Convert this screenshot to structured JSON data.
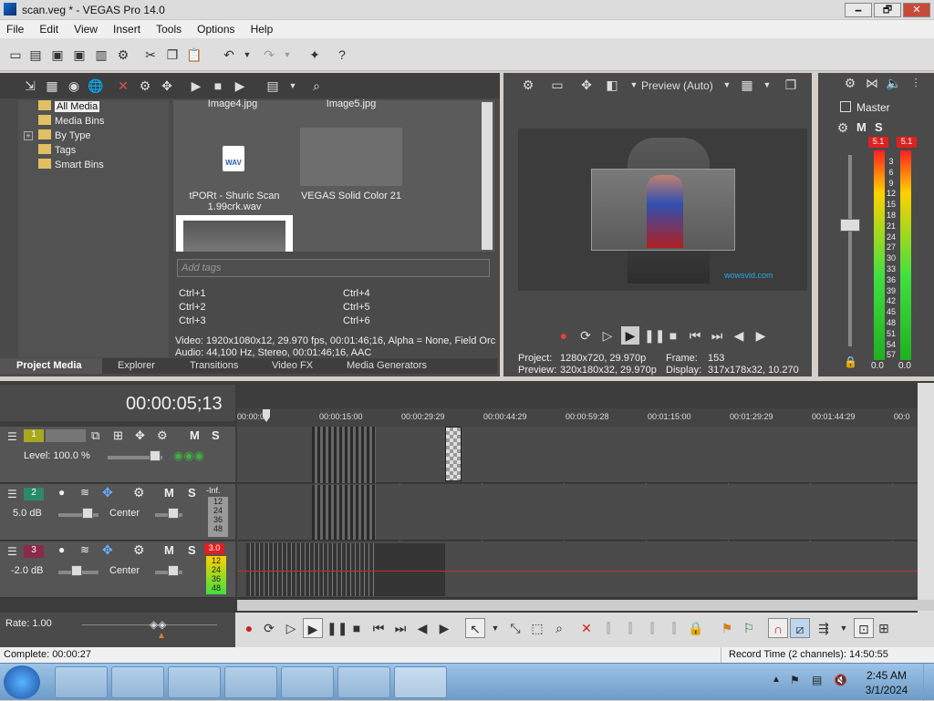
{
  "window": {
    "title": "scan.veg * - VEGAS Pro 14.0",
    "min": "🗕",
    "max": "🗗",
    "close": "✕"
  },
  "menu": [
    "File",
    "Edit",
    "View",
    "Insert",
    "Tools",
    "Options",
    "Help"
  ],
  "tree": [
    "All Media",
    "Media Bins",
    "By Type",
    "Tags",
    "Smart Bins"
  ],
  "tree_expand": "+",
  "media": {
    "top_captions": [
      "Image4.jpg",
      "Image5.jpg"
    ],
    "wav_caption": "tPORt - Shuric Scan 1.99crk.wav",
    "wav_icon_text": "WAV",
    "solid_caption": "VEGAS Solid Color 21",
    "tags_placeholder": "Add tags",
    "shortcuts": [
      "Ctrl+1",
      "Ctrl+4",
      "Ctrl+2",
      "Ctrl+5",
      "Ctrl+3",
      "Ctrl+6"
    ],
    "video_info": "Video: 1920x1080x12, 29.970 fps, 00:01:46;16, Alpha = None, Field Orc",
    "audio_info": "Audio: 44,100 Hz, Stereo, 00:01:46;16, AAC"
  },
  "tabs": [
    "Project Media",
    "Explorer",
    "Transitions",
    "Video FX",
    "Media Generators"
  ],
  "preview": {
    "mode": "Preview (Auto)",
    "project_label": "Project:",
    "project_value": "1280x720, 29.970p",
    "frame_label": "Frame:",
    "frame_value": "153",
    "preview_label": "Preview:",
    "preview_value": "320x180x32, 29.970p",
    "display_label": "Display:",
    "display_value": "317x178x32, 10.270",
    "watermark": "wowsvid.com"
  },
  "mixer": {
    "title": "Master",
    "m": "M",
    "s": "S",
    "peak_left": "5.1",
    "peak_right": "5.1",
    "scale": [
      "3",
      "6",
      "9",
      "12",
      "15",
      "18",
      "21",
      "24",
      "27",
      "30",
      "33",
      "36",
      "39",
      "42",
      "45",
      "48",
      "51",
      "54",
      "57"
    ],
    "bottom_left": "0.0",
    "bottom_right": "0.0"
  },
  "timeline": {
    "timecode": "00:00:05;13",
    "ruler": [
      "00:00:00",
      "00:00:15:00",
      "00:00:29:29",
      "00:00:44:29",
      "00:00:59:28",
      "00:01:15:00",
      "00:01:29:29",
      "00:01:44:29",
      "00:0"
    ],
    "tracks": [
      {
        "num": "1",
        "label": "Level: 100.0 %",
        "m": "M",
        "s": "S"
      },
      {
        "num": "2",
        "label": "5.0 dB",
        "pan": "Center",
        "m": "M",
        "s": "S",
        "meter": "-Inf."
      },
      {
        "num": "3",
        "label": "-2.0 dB",
        "pan": "Center",
        "m": "M",
        "s": "S",
        "meter": "3.0"
      }
    ],
    "meter_scale": [
      "12",
      "24",
      "36",
      "48"
    ],
    "rate": "Rate: 1.00"
  },
  "status": {
    "complete": "Complete: 00:00:27",
    "record": "Record Time (2 channels): 14:50:55"
  },
  "clock": {
    "time": "2:45 AM",
    "date": "3/1/2024"
  }
}
